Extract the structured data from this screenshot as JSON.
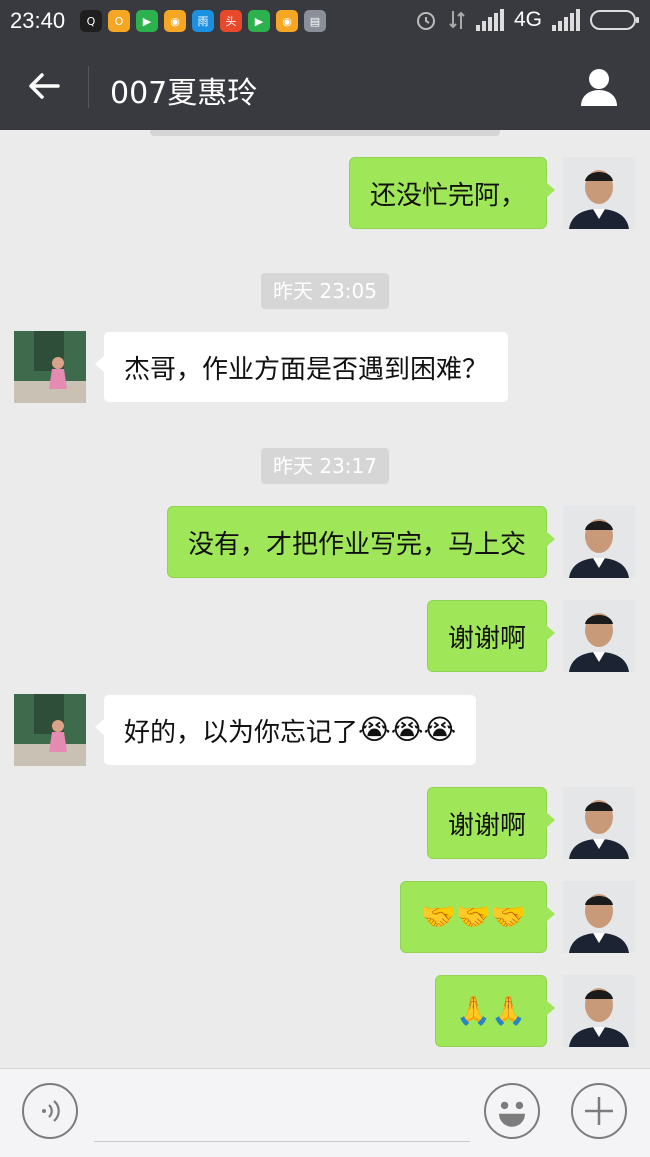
{
  "status_bar": {
    "time": "23:40",
    "network": "4G",
    "apps": [
      {
        "icon": "qq-icon",
        "color": "#1e1e1e",
        "glyph": "Q"
      },
      {
        "icon": "app-o-icon",
        "color": "#f5a623",
        "glyph": "O"
      },
      {
        "icon": "video-icon",
        "color": "#2bb24c",
        "glyph": "▶"
      },
      {
        "icon": "weibo-icon",
        "color": "#f5a623",
        "glyph": "◉"
      },
      {
        "icon": "rain-icon",
        "color": "#1b8fe0",
        "glyph": "雨"
      },
      {
        "icon": "news-icon",
        "color": "#e8482c",
        "glyph": "头"
      },
      {
        "icon": "video-icon",
        "color": "#2bb24c",
        "glyph": "▶"
      },
      {
        "icon": "weibo-icon",
        "color": "#f5a623",
        "glyph": "◉"
      },
      {
        "icon": "sim-icon",
        "color": "#8a8f99",
        "glyph": "▤"
      }
    ]
  },
  "header": {
    "title": "007夏惠玲"
  },
  "messages": {
    "m1": {
      "text": "还没忙完阿，",
      "side": "right"
    },
    "t1": "昨天 23:05",
    "m2": {
      "text": "杰哥，作业方面是否遇到困难？",
      "side": "left"
    },
    "t2": "昨天 23:17",
    "m3": {
      "text": "没有，才把作业写完，马上交",
      "side": "right"
    },
    "m4": {
      "text": "谢谢啊",
      "side": "right"
    },
    "m5": {
      "text": "好的，以为你忘记了",
      "emoji": "😭😭😭",
      "side": "left"
    },
    "m6": {
      "text": "谢谢啊",
      "side": "right"
    },
    "m7": {
      "emoji": "🤝🤝🤝",
      "side": "right"
    },
    "m8": {
      "emoji": "🙏🙏",
      "side": "right"
    }
  },
  "colors": {
    "header_bg": "#393a3f",
    "chat_bg": "#ebebeb",
    "outgoing_bubble": "#9fe658",
    "incoming_bubble": "#ffffff",
    "timestamp_bg": "#d6d6d6"
  }
}
